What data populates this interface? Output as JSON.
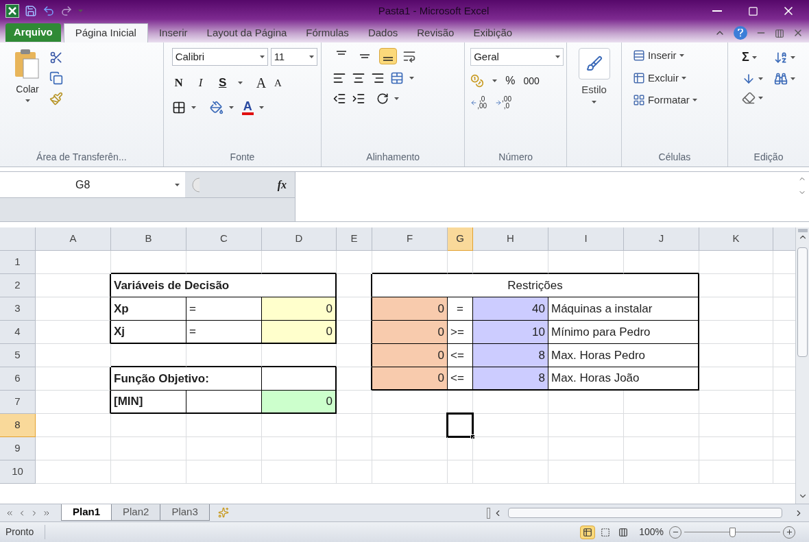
{
  "window": {
    "title": "Pasta1 - Microsoft Excel"
  },
  "ribbon_tabs": [
    {
      "label": "Arquivo",
      "kind": "file",
      "selected": false
    },
    {
      "label": "Página Inicial",
      "kind": "tab",
      "selected": true
    },
    {
      "label": "Inserir",
      "kind": "tab",
      "selected": false
    },
    {
      "label": "Layout da Página",
      "kind": "tab",
      "selected": false
    },
    {
      "label": "Fórmulas",
      "kind": "tab",
      "selected": false
    },
    {
      "label": "Dados",
      "kind": "tab",
      "selected": false
    },
    {
      "label": "Revisão",
      "kind": "tab",
      "selected": false
    },
    {
      "label": "Exibição",
      "kind": "tab",
      "selected": false
    }
  ],
  "clipboard": {
    "label": "Área de Transferên...",
    "paste": "Colar"
  },
  "font": {
    "label": "Fonte",
    "font_name": "Calibri",
    "font_size": "11",
    "bold": "N",
    "italic": "I",
    "underline": "S",
    "grow": "A",
    "shrink": "A",
    "font_color": "A"
  },
  "alignment": {
    "label": "Alinhamento",
    "vertical": [
      {
        "kind": "top",
        "selected": false
      },
      {
        "kind": "middle",
        "selected": false
      },
      {
        "kind": "bottom",
        "selected": true
      }
    ]
  },
  "number": {
    "label": "Número",
    "format": "Geral",
    "percent": "%",
    "thousands": "000",
    "increase_decimal": [
      ",0",
      ",00"
    ],
    "decrease_decimal": [
      ",00",
      ",0"
    ]
  },
  "styles": {
    "label": "Estilo"
  },
  "cells_group": {
    "label": "Células",
    "buttons": [
      "Inserir",
      "Excluir",
      "Formatar"
    ]
  },
  "editing": {
    "label": "Edição",
    "sum": "Σ"
  },
  "formula_bar": {
    "name_box": "G8",
    "fx": "fx"
  },
  "columns": [
    {
      "label": "A",
      "selected": false
    },
    {
      "label": "B",
      "selected": false
    },
    {
      "label": "C",
      "selected": false
    },
    {
      "label": "D",
      "selected": false
    },
    {
      "label": "E",
      "selected": false
    },
    {
      "label": "F",
      "selected": false
    },
    {
      "label": "G",
      "selected": true
    },
    {
      "label": "H",
      "selected": false
    },
    {
      "label": "I",
      "selected": false
    },
    {
      "label": "J",
      "selected": false
    },
    {
      "label": "K",
      "selected": false
    }
  ],
  "rows": [
    {
      "label": "1",
      "selected": false,
      "cells": []
    },
    {
      "label": "2",
      "selected": false,
      "cells": [
        null,
        {
          "text": "Variáveis de Decisão",
          "kind": "text",
          "bold": true
        },
        {
          "kind": "merged"
        },
        {
          "kind": "merged"
        },
        null,
        {
          "text": "Restrições",
          "kind": "title",
          "bold": false
        },
        {
          "kind": "merged"
        },
        {
          "kind": "merged"
        },
        {
          "kind": "merged"
        },
        {
          "kind": "merged"
        }
      ]
    },
    {
      "label": "3",
      "selected": false,
      "cells": [
        null,
        {
          "text": "Xp",
          "kind": "text",
          "bold": true
        },
        {
          "text": "=",
          "kind": "text",
          "bold": false
        },
        {
          "text": "0",
          "kind": "number",
          "bold": false,
          "color": "#ffffcc"
        },
        null,
        {
          "text": "0",
          "kind": "number",
          "bold": false,
          "color": "#f8cbad"
        },
        {
          "text": "=",
          "kind": "title",
          "bold": false
        },
        {
          "text": "40",
          "kind": "number",
          "bold": false,
          "color": "#ccccff"
        },
        {
          "text": "Máquinas a instalar",
          "kind": "text",
          "bold": false
        },
        {
          "kind": "merged"
        }
      ]
    },
    {
      "label": "4",
      "selected": false,
      "cells": [
        null,
        {
          "text": "Xj",
          "kind": "text",
          "bold": true
        },
        {
          "text": "=",
          "kind": "text",
          "bold": false
        },
        {
          "text": "0",
          "kind": "number",
          "bold": false,
          "color": "#ffffcc"
        },
        null,
        {
          "text": "0",
          "kind": "number",
          "bold": false,
          "color": "#f8cbad"
        },
        {
          "text": ">=",
          "kind": "text",
          "bold": false
        },
        {
          "text": "10",
          "kind": "number",
          "bold": false,
          "color": "#ccccff"
        },
        {
          "text": "Mínimo para Pedro",
          "kind": "text",
          "bold": false
        },
        {
          "kind": "merged"
        }
      ]
    },
    {
      "label": "5",
      "selected": false,
      "cells": [
        null,
        null,
        null,
        null,
        null,
        {
          "text": "0",
          "kind": "number",
          "bold": false,
          "color": "#f8cbad"
        },
        {
          "text": "<=",
          "kind": "text",
          "bold": false
        },
        {
          "text": "8",
          "kind": "number",
          "bold": false,
          "color": "#ccccff"
        },
        {
          "text": "Max. Horas Pedro",
          "kind": "text",
          "bold": false
        },
        {
          "kind": "merged"
        }
      ]
    },
    {
      "label": "6",
      "selected": false,
      "cells": [
        null,
        {
          "text": "Função Objetivo:",
          "kind": "text",
          "bold": true
        },
        {
          "kind": "merged"
        },
        null,
        null,
        {
          "text": "0",
          "kind": "number",
          "bold": false,
          "color": "#f8cbad"
        },
        {
          "text": "<=",
          "kind": "text",
          "bold": false
        },
        {
          "text": "8",
          "kind": "number",
          "bold": false,
          "color": "#ccccff"
        },
        {
          "text": "Max. Horas João",
          "kind": "text",
          "bold": false
        },
        {
          "kind": "merged"
        }
      ]
    },
    {
      "label": "7",
      "selected": false,
      "cells": [
        null,
        {
          "text": "[MIN]",
          "kind": "text",
          "bold": true
        },
        null,
        {
          "text": "0",
          "kind": "number",
          "bold": false,
          "color": "#ccffcc"
        }
      ]
    },
    {
      "label": "8",
      "selected": true,
      "cells": [
        null,
        null,
        null,
        null,
        null,
        null,
        {
          "kind": "cursor",
          "selected": true
        }
      ]
    },
    {
      "label": "9",
      "selected": false,
      "cells": []
    },
    {
      "label": "10",
      "selected": false,
      "cells": []
    }
  ],
  "sheet_tabs": [
    {
      "label": "Plan1",
      "selected": true
    },
    {
      "label": "Plan2",
      "selected": false
    },
    {
      "label": "Plan3",
      "selected": false
    }
  ],
  "status_bar": {
    "status": "Pronto",
    "views": [
      {
        "kind": "normal",
        "selected": true
      },
      {
        "kind": "layout",
        "selected": false
      },
      {
        "kind": "break",
        "selected": false
      }
    ],
    "zoom": "100%",
    "zoom_level": {
      "level": 0.5
    }
  }
}
